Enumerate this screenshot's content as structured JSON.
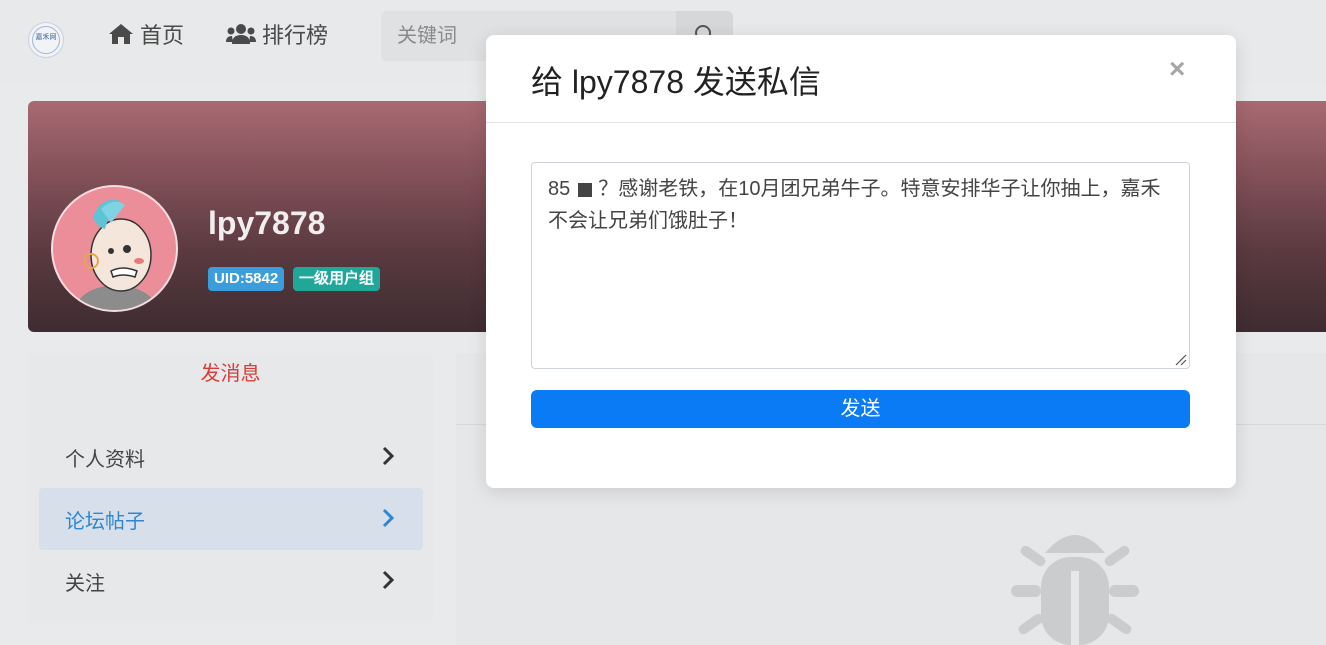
{
  "navbar": {
    "logo_text": "嘉禾网",
    "home_label": "首页",
    "rank_label": "排行榜",
    "search_placeholder": "关键词"
  },
  "profile": {
    "username": "lpy7878",
    "uid_badge": "UID:5842",
    "group_badge": "一级用户组"
  },
  "sidebar": {
    "send_message_link": "发消息",
    "items": [
      {
        "label": "个人资料",
        "active": false
      },
      {
        "label": "论坛帖子",
        "active": true
      },
      {
        "label": "关注",
        "active": false
      }
    ]
  },
  "modal": {
    "title": "给 lpy7878 发送私信",
    "close_symbol": "×",
    "message_prefix": "85",
    "message_text": "？感谢老铁，在10月团兄弟牛子。特意安排华子让你抽上，嘉禾不会让兄弟们饿肚子！",
    "send_label": "发送"
  },
  "colors": {
    "send_button": "#0a7bf5",
    "send_message_link": "#d43f3a",
    "active_menu_text": "#2f86d0",
    "uid_badge": "#3b9ddb",
    "group_badge": "#1fa79a"
  }
}
